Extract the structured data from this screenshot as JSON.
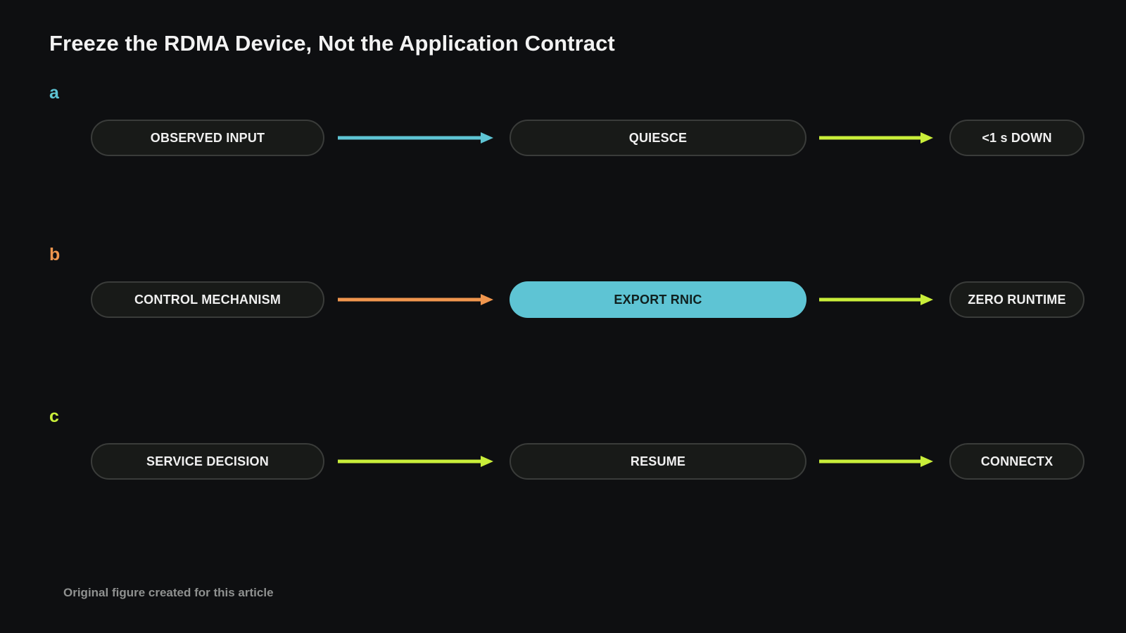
{
  "title": "Freeze the RDMA Device, Not the Application Contract",
  "colors": {
    "background": "#0e0f11",
    "cyan": "#5ec4d4",
    "orange": "#f0964e",
    "lime": "#c9ee3a",
    "pill_fill": "#181a18",
    "pill_border": "#3a3c3a"
  },
  "rows": [
    {
      "letter": "a",
      "letter_color": "#5ec4d4",
      "nodes": [
        {
          "label": "OBSERVED INPUT",
          "highlight": false
        },
        {
          "label": "QUIESCE",
          "highlight": false
        },
        {
          "label": "<1 s DOWN",
          "highlight": false
        }
      ],
      "arrow_colors": [
        "#5ec4d4",
        "#c9ee3a"
      ]
    },
    {
      "letter": "b",
      "letter_color": "#f0964e",
      "nodes": [
        {
          "label": "CONTROL MECHANISM",
          "highlight": false
        },
        {
          "label": "EXPORT RNIC",
          "highlight": true
        },
        {
          "label": "ZERO RUNTIME",
          "highlight": false
        }
      ],
      "arrow_colors": [
        "#f0964e",
        "#c9ee3a"
      ]
    },
    {
      "letter": "c",
      "letter_color": "#c9ee3a",
      "nodes": [
        {
          "label": "SERVICE DECISION",
          "highlight": false
        },
        {
          "label": "RESUME",
          "highlight": false
        },
        {
          "label": "CONNECTX",
          "highlight": false
        }
      ],
      "arrow_colors": [
        "#c9ee3a",
        "#c9ee3a"
      ]
    }
  ],
  "footer": "Original figure created for this article"
}
